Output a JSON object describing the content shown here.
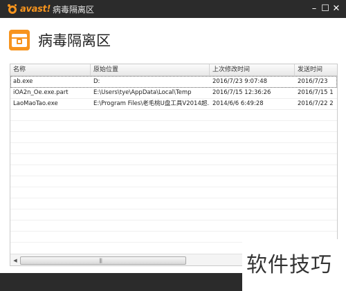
{
  "titlebar": {
    "brand": "avast!",
    "title": "病毒隔离区",
    "buttons": {
      "minimize": "–",
      "maximize": "☐",
      "close": "✕"
    }
  },
  "header": {
    "icon": "chest-lock-icon",
    "title": "病毒隔离区",
    "accent": "#f7941d"
  },
  "table": {
    "columns": [
      "名称",
      "原始位置",
      "上次修改时间",
      "发送时间"
    ],
    "rows": [
      {
        "name": "ab.exe",
        "location": "D:",
        "modified": "2016/7/23 9:07:48",
        "sent": "2016/7/23 "
      },
      {
        "name": "iOA2n_Oe.exe.part",
        "location": "E:\\Users\\tye\\AppData\\Local\\Temp",
        "modified": "2016/7/15 12:36:26",
        "sent": "2016/7/15 1"
      },
      {
        "name": "LaoMaoTao.exe",
        "location": "E:\\Program Files\\老毛桃U盘工具V2014超...",
        "modified": "2014/6/6 6:49:28",
        "sent": "2016/7/22 2"
      }
    ],
    "selected_row": 0
  },
  "scrollbar": {
    "left_arrow": "◀",
    "grip": "|||"
  },
  "watermark": "软件技巧"
}
